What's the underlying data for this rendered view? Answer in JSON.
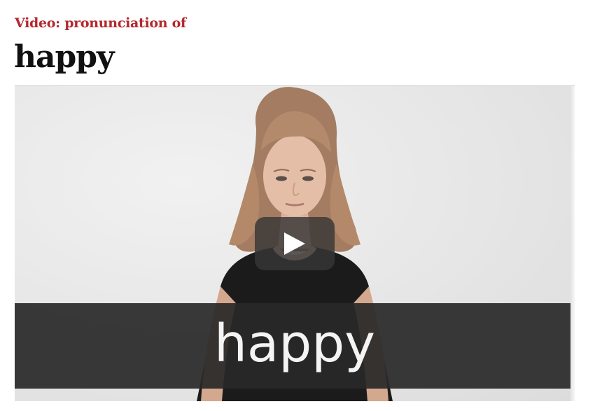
{
  "header": {
    "kicker": "Video: pronunciation of",
    "word": "happy"
  },
  "video": {
    "caption_word": "happy",
    "play_icon": "play-icon",
    "colors": {
      "kicker": "#b3282d",
      "caption_band": "#282828",
      "play_button": "#373737"
    }
  }
}
